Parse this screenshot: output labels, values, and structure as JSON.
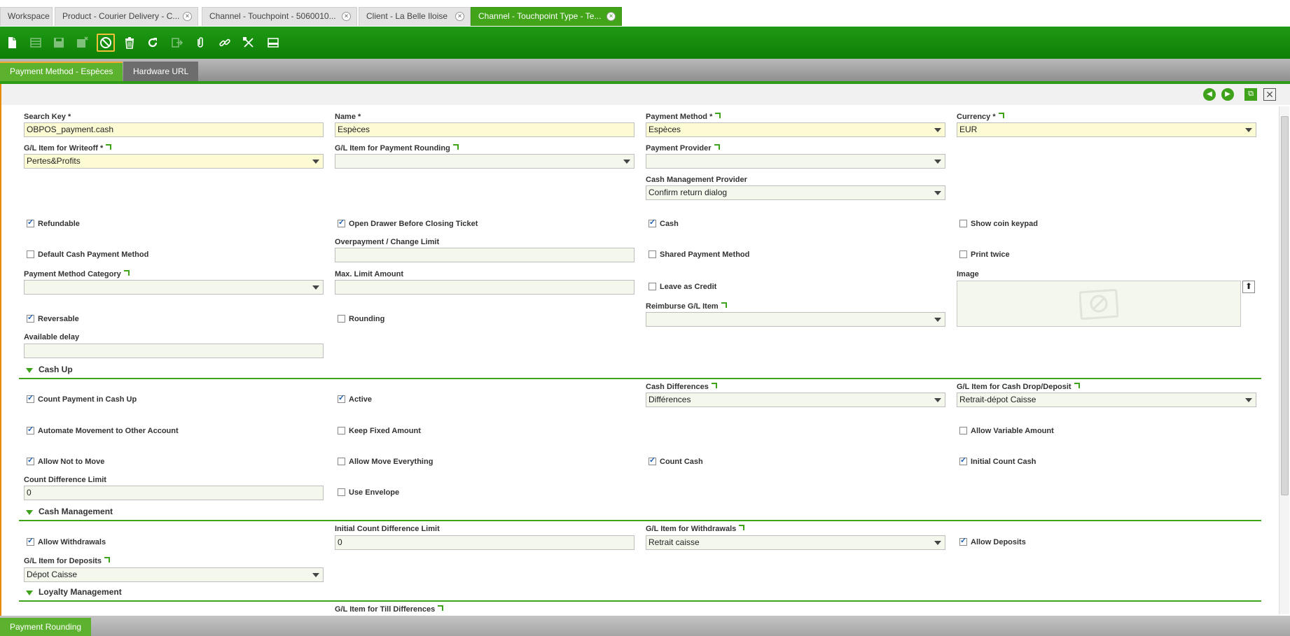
{
  "window_tabs": [
    {
      "label": "Workspace",
      "closable": false,
      "active": false
    },
    {
      "label": "Product - Courier Delivery - C...",
      "closable": true,
      "active": false
    },
    {
      "label": "Channel - Touchpoint - 5060010...",
      "closable": true,
      "active": false
    },
    {
      "label": "Client - La Belle Iloise",
      "closable": true,
      "active": false
    },
    {
      "label": "Channel - Touchpoint Type - Te...",
      "closable": true,
      "active": true
    }
  ],
  "close_glyph": "×",
  "toolbar": {
    "icons": [
      "new-document-icon",
      "grid-view-icon",
      "save-icon",
      "save-close-icon",
      "undo-icon",
      "delete-icon",
      "refresh-icon",
      "export-icon",
      "attachment-icon",
      "link-icon",
      "tools-icon",
      "layout-icon"
    ]
  },
  "subtabs": {
    "active": "Payment Method - Espèces",
    "other": "Hardware URL"
  },
  "form": {
    "search_key": {
      "label": "Search Key *",
      "value": "OBPOS_payment.cash"
    },
    "name": {
      "label": "Name *",
      "value": "Espèces"
    },
    "payment_method": {
      "label": "Payment Method *",
      "value": "Espèces"
    },
    "currency": {
      "label": "Currency *",
      "value": "EUR"
    },
    "gl_writeoff": {
      "label": "G/L Item for Writeoff *",
      "value": "Pertes&Profits"
    },
    "gl_rounding": {
      "label": "G/L Item for Payment Rounding",
      "value": ""
    },
    "payment_provider": {
      "label": "Payment Provider",
      "value": ""
    },
    "cash_mgmt_provider": {
      "label": "Cash Management Provider",
      "value": "Confirm return dialog"
    },
    "refundable": {
      "label": "Refundable",
      "checked": true
    },
    "open_drawer": {
      "label": "Open Drawer Before Closing Ticket",
      "checked": true
    },
    "cash": {
      "label": "Cash",
      "checked": true
    },
    "show_coin_keypad": {
      "label": "Show coin keypad",
      "checked": false
    },
    "default_cash": {
      "label": "Default Cash Payment Method",
      "checked": false
    },
    "overpayment": {
      "label": "Overpayment / Change Limit",
      "value": ""
    },
    "shared_payment": {
      "label": "Shared Payment Method",
      "checked": false
    },
    "print_twice": {
      "label": "Print twice",
      "checked": false
    },
    "payment_category": {
      "label": "Payment Method Category",
      "value": ""
    },
    "max_limit": {
      "label": "Max. Limit Amount",
      "value": ""
    },
    "leave_as_credit": {
      "label": "Leave as Credit",
      "checked": false
    },
    "image": {
      "label": "Image"
    },
    "reimburse_gl": {
      "label": "Reimburse G/L Item",
      "value": ""
    },
    "reversable": {
      "label": "Reversable",
      "checked": true
    },
    "rounding": {
      "label": "Rounding",
      "checked": false
    },
    "available_delay": {
      "label": "Available delay",
      "value": ""
    }
  },
  "cash_up": {
    "title": "Cash Up",
    "count_payment": {
      "label": "Count Payment in Cash Up",
      "checked": true
    },
    "active": {
      "label": "Active",
      "checked": true
    },
    "cash_differences": {
      "label": "Cash Differences",
      "value": "Différences"
    },
    "gl_cash_drop": {
      "label": "G/L Item for Cash Drop/Deposit",
      "value": "Retrait-dépot Caisse"
    },
    "automate_movement": {
      "label": "Automate Movement to Other Account",
      "checked": true
    },
    "keep_fixed": {
      "label": "Keep Fixed Amount",
      "checked": false
    },
    "allow_variable": {
      "label": "Allow Variable Amount",
      "checked": false
    },
    "allow_not_move": {
      "label": "Allow Not to Move",
      "checked": true
    },
    "allow_move_everything": {
      "label": "Allow Move Everything",
      "checked": false
    },
    "count_cash": {
      "label": "Count Cash",
      "checked": true
    },
    "initial_count_cash": {
      "label": "Initial Count Cash",
      "checked": true
    },
    "count_diff_limit": {
      "label": "Count Difference Limit",
      "value": "0"
    },
    "use_envelope": {
      "label": "Use Envelope",
      "checked": false
    }
  },
  "cash_management": {
    "title": "Cash Management",
    "allow_withdrawals": {
      "label": "Allow Withdrawals",
      "checked": true
    },
    "initial_count_diff": {
      "label": "Initial Count Difference Limit",
      "value": "0"
    },
    "gl_withdrawals": {
      "label": "G/L Item for Withdrawals",
      "value": "Retrait caisse"
    },
    "allow_deposits": {
      "label": "Allow Deposits",
      "checked": true
    },
    "gl_deposits": {
      "label": "G/L Item for Deposits",
      "value": "Dépot Caisse"
    }
  },
  "loyalty": {
    "title": "Loyalty Management",
    "gl_till_diff": {
      "label": "G/L Item for Till Differences"
    }
  },
  "bottom_tab": "Payment Rounding"
}
